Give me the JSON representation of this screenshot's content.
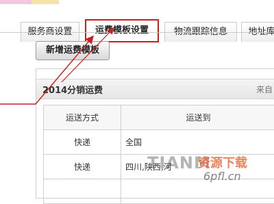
{
  "tabs": [
    {
      "label": "服务商设置",
      "active": false
    },
    {
      "label": "运费模板设置",
      "active": true
    },
    {
      "label": "物流跟踪信息",
      "active": false
    },
    {
      "label": "地址库",
      "active": false
    }
  ],
  "toolbar": {
    "new_template_label": "新增运费模板"
  },
  "panel": {
    "title": "2014分销运费",
    "right_text": "来自",
    "table": {
      "headers": [
        "运送方式",
        "运送到"
      ],
      "rows": [
        [
          "快递",
          "全国"
        ],
        [
          "快递",
          "四川,陕西,河"
        ]
      ]
    }
  },
  "watermark": {
    "logo": "TIANM",
    "cn": "资源下载",
    "url": "6pfl.cn"
  },
  "colors": {
    "highlight": "#c8201e",
    "accent_watermark": "#ee5828"
  }
}
